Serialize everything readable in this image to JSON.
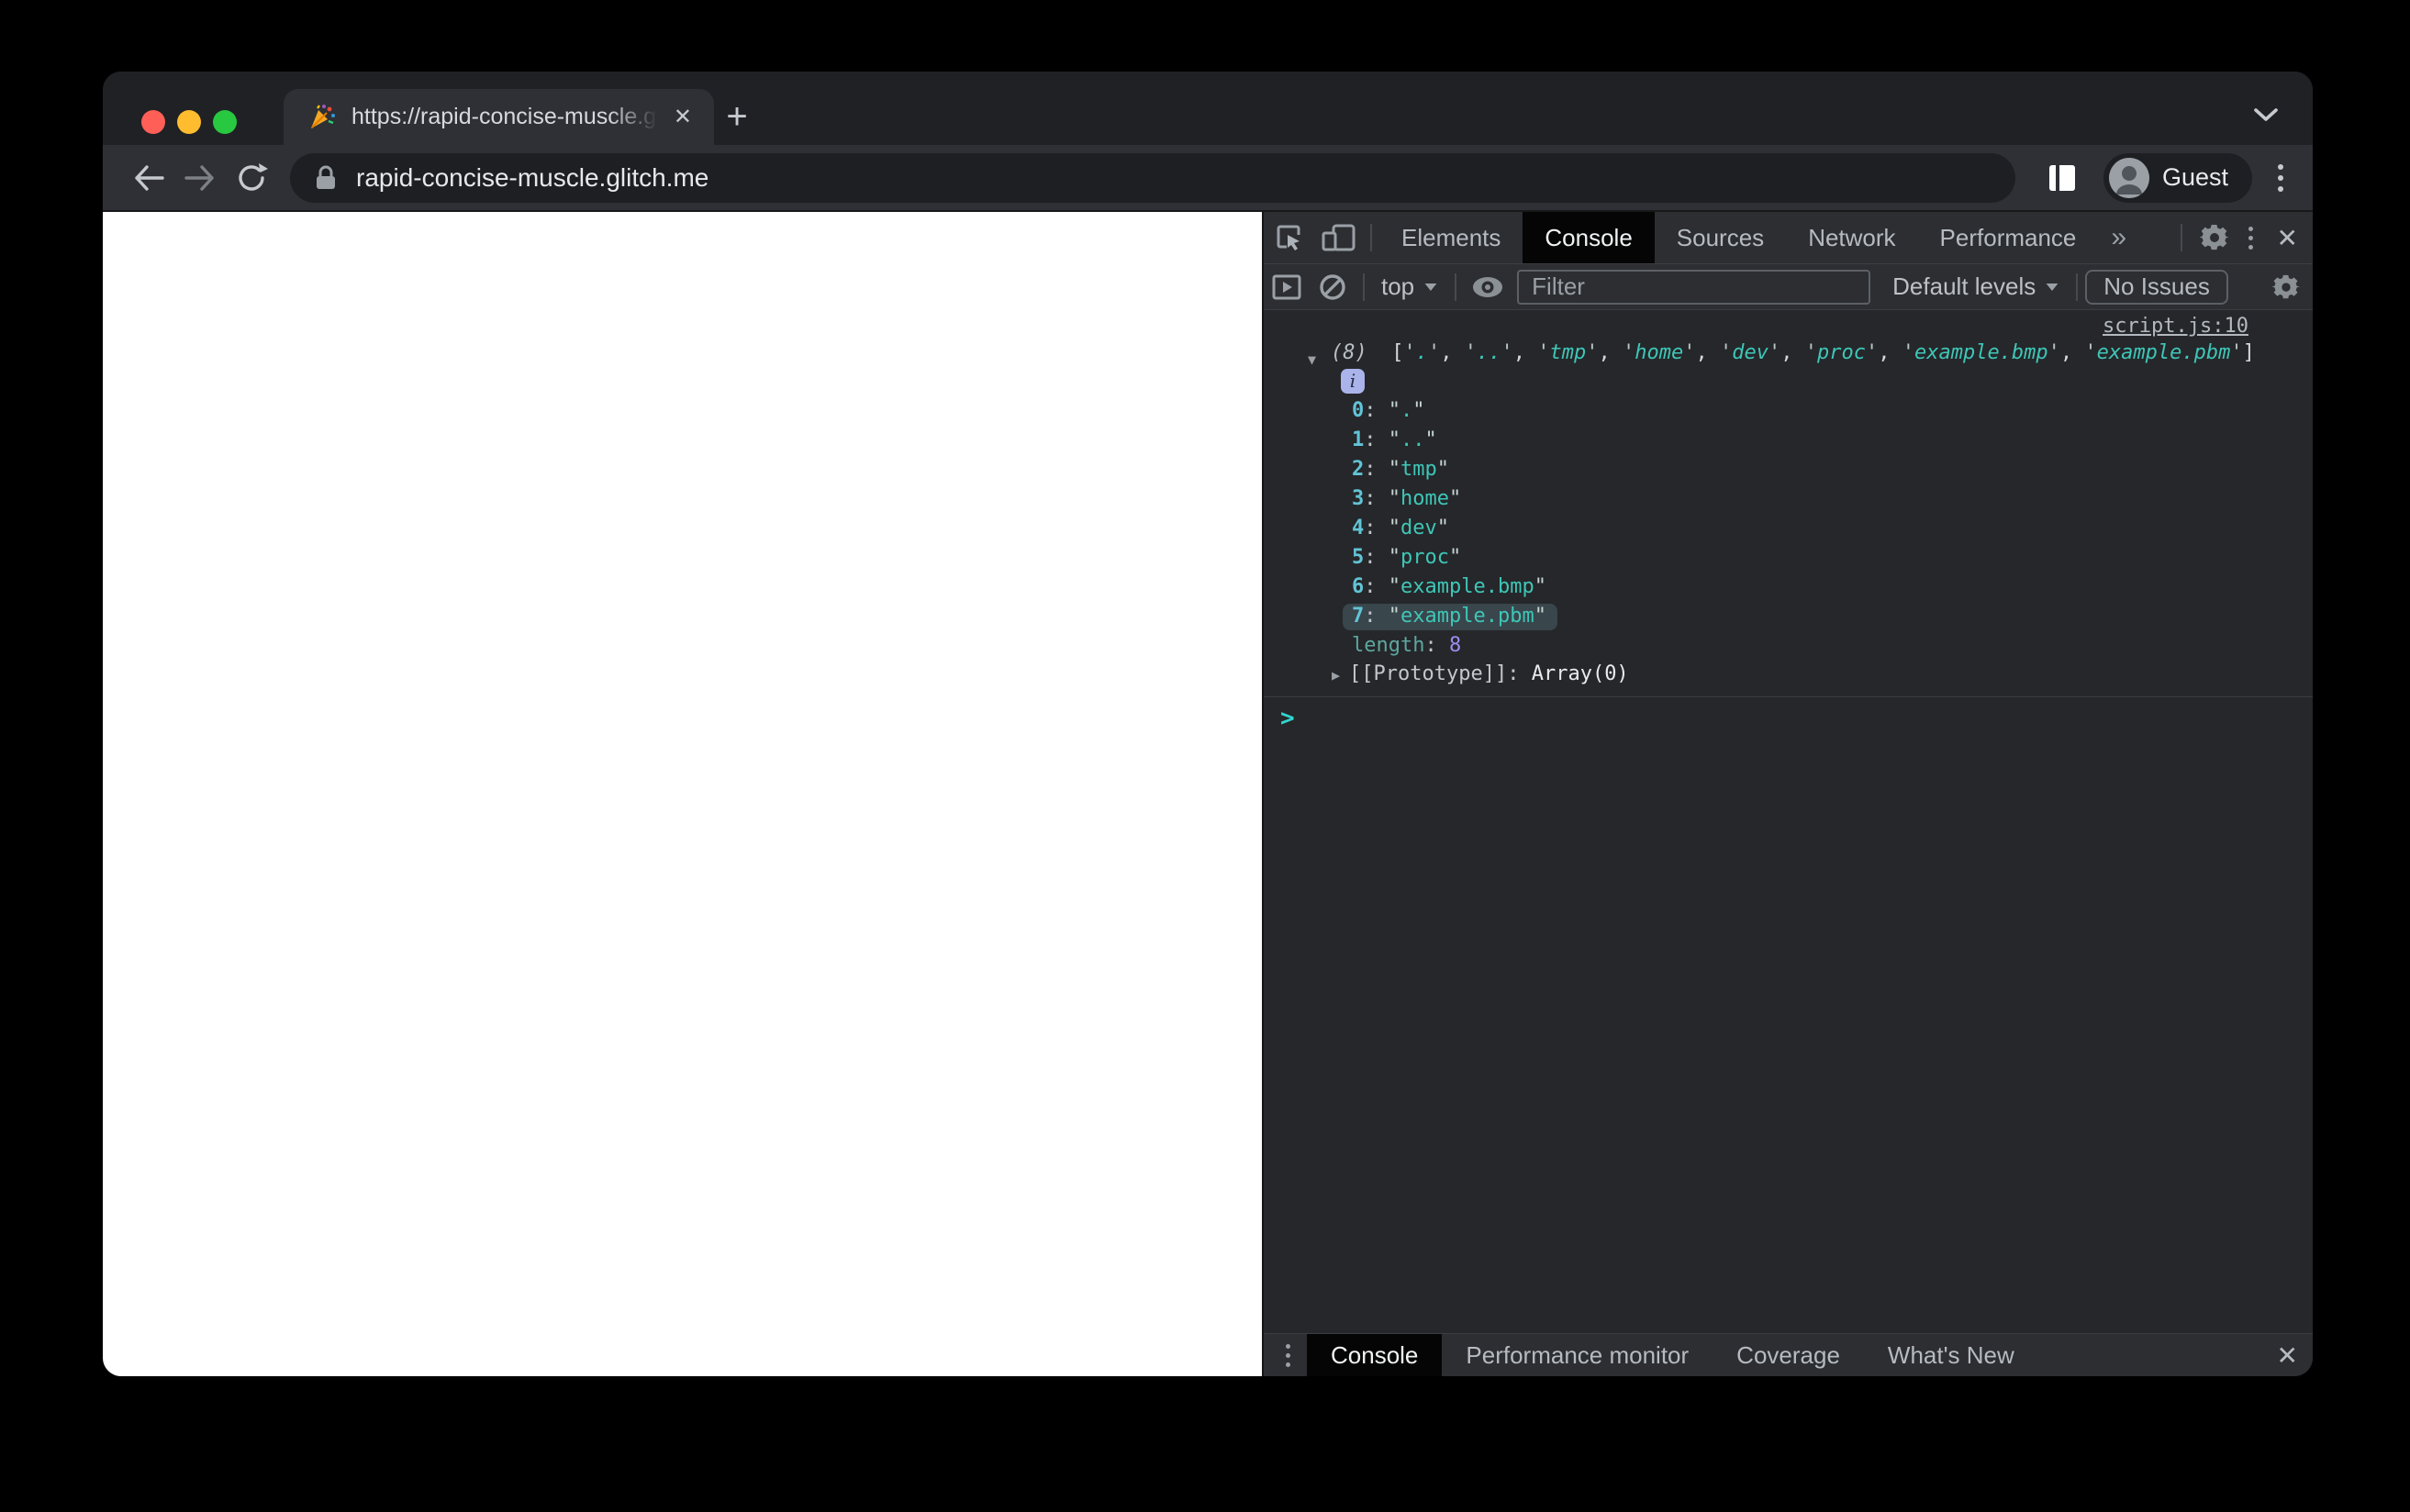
{
  "colors": {
    "traffic_red": "#ff5f57",
    "traffic_yellow": "#febc2e",
    "traffic_green": "#28c840",
    "string_teal": "#3fc6b7",
    "number_violet": "#9d8df1",
    "console_bg": "#25272a",
    "toolbar_bg": "#2c2e32",
    "active_tab_bg": "#050505"
  },
  "browser": {
    "tab": {
      "favicon": "party-popper",
      "title": "https://rapid-concise-muscle.g",
      "close_label": "✕"
    },
    "new_tab_label": "+",
    "url": "rapid-concise-muscle.glitch.me",
    "profile_label": "Guest"
  },
  "devtools": {
    "tabs": [
      "Elements",
      "Console",
      "Sources",
      "Network",
      "Performance"
    ],
    "active_tab": "Console",
    "more_tabs_label": "»",
    "close_label": "✕",
    "context_selector": "top",
    "filter_placeholder": "Filter",
    "levels_label": "Default levels",
    "issues_label": "No Issues",
    "console": {
      "source_link": "script.js:10",
      "expander": "▼",
      "count_label": "(8)",
      "preview_items": [
        ".",
        "..",
        "tmp",
        "home",
        "dev",
        "proc",
        "example.bmp",
        "example.pbm"
      ],
      "info_badge": "i",
      "entries": [
        {
          "index": "0",
          "value": ".",
          "highlight": false
        },
        {
          "index": "1",
          "value": "..",
          "highlight": false
        },
        {
          "index": "2",
          "value": "tmp",
          "highlight": false
        },
        {
          "index": "3",
          "value": "home",
          "highlight": false
        },
        {
          "index": "4",
          "value": "dev",
          "highlight": false
        },
        {
          "index": "5",
          "value": "proc",
          "highlight": false
        },
        {
          "index": "6",
          "value": "example.bmp",
          "highlight": false
        },
        {
          "index": "7",
          "value": "example.pbm",
          "highlight": true
        }
      ],
      "length_label": "length",
      "length_value": "8",
      "prototype_expander": "▶",
      "prototype_label": "[[Prototype]]",
      "prototype_value": "Array(0)",
      "prompt": ">"
    },
    "drawer": {
      "tabs": [
        "Console",
        "Performance monitor",
        "Coverage",
        "What's New"
      ],
      "active_tab": "Console",
      "close_label": "✕"
    }
  }
}
